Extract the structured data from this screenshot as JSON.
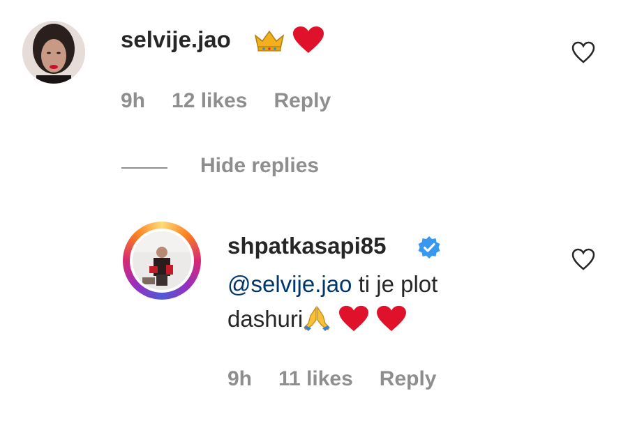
{
  "comments": [
    {
      "username": "selvije.jao",
      "emojis": [
        "crown-emoji",
        "red-heart-emoji"
      ],
      "time": "9h",
      "likes": "12 likes",
      "reply": "Reply"
    }
  ],
  "thread": {
    "hide_replies_label": "Hide replies"
  },
  "replies": [
    {
      "username": "shpatkasapi85",
      "verified": true,
      "mention": "@selvije.jao",
      "text_line1": " ti je plot",
      "text_line2": "dashuri",
      "emojis": [
        "folded-hands-emoji",
        "red-heart-emoji",
        "red-heart-emoji"
      ],
      "time": "9h",
      "likes": "11 likes",
      "reply": "Reply"
    }
  ],
  "colors": {
    "text": "#262626",
    "meta": "#8e8e8e",
    "mention": "#00376b",
    "verified": "#3897f0",
    "heart": "#ed4956"
  }
}
